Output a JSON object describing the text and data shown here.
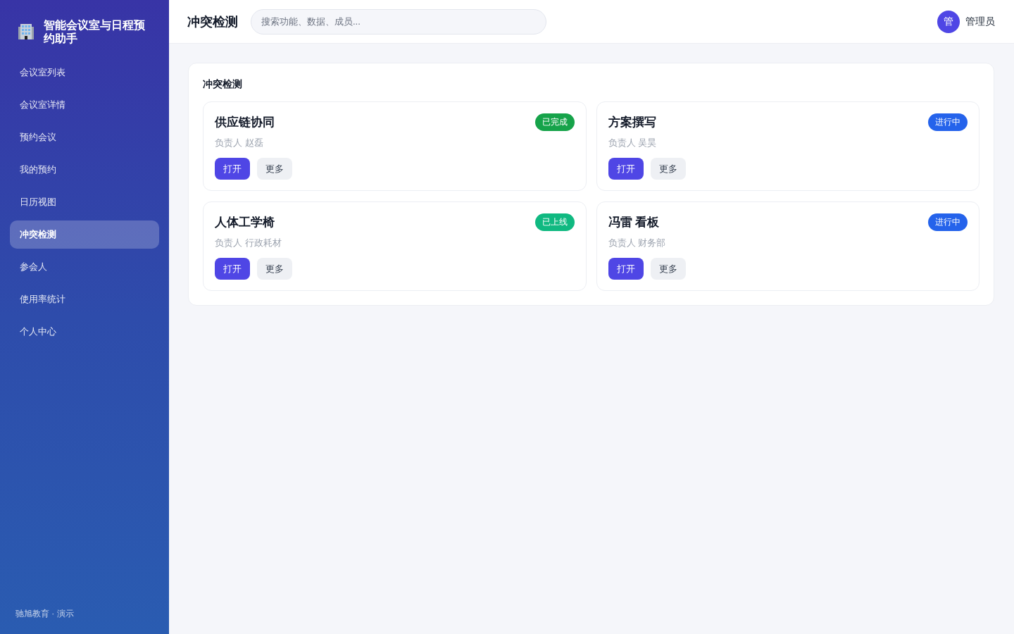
{
  "sidebar": {
    "title": "智能会议室与日程预约助手",
    "items": [
      {
        "label": "会议室列表",
        "selected": false
      },
      {
        "label": "会议室详情",
        "selected": false
      },
      {
        "label": "预约会议",
        "selected": false
      },
      {
        "label": "我的预约",
        "selected": false
      },
      {
        "label": "日历视图",
        "selected": false
      },
      {
        "label": "冲突检测",
        "selected": true
      },
      {
        "label": "参会人",
        "selected": false
      },
      {
        "label": "使用率统计",
        "selected": false
      },
      {
        "label": "个人中心",
        "selected": false
      }
    ],
    "footer": "驰旭教育 · 演示"
  },
  "header": {
    "title": "冲突检测",
    "search": {
      "placeholder": "搜索功能、数据、成员..."
    },
    "user": {
      "avatar": "管",
      "name": "管理员"
    }
  },
  "panel": {
    "title": "冲突检测",
    "cards": [
      {
        "title": "供应链协同",
        "owner": "负责人 赵磊",
        "status": "已完成",
        "color": "#16a34a",
        "buttons": [
          {
            "label": "打开",
            "kind": "primary"
          },
          {
            "label": "更多",
            "kind": "secondary"
          }
        ]
      },
      {
        "title": "方案撰写",
        "owner": "负责人 吴昊",
        "status": "进行中",
        "color": "#2563eb",
        "buttons": [
          {
            "label": "打开",
            "kind": "primary"
          },
          {
            "label": "更多",
            "kind": "secondary"
          }
        ]
      },
      {
        "title": "人体工学椅",
        "owner": "负责人 行政耗材",
        "status": "已上线",
        "color": "#10b981",
        "buttons": [
          {
            "label": "打开",
            "kind": "primary"
          },
          {
            "label": "更多",
            "kind": "secondary"
          }
        ]
      },
      {
        "title": "冯雷 看板",
        "owner": "负责人 财务部",
        "status": "进行中",
        "color": "#2563eb",
        "buttons": [
          {
            "label": "打开",
            "kind": "primary"
          },
          {
            "label": "更多",
            "kind": "secondary"
          }
        ]
      }
    ]
  }
}
